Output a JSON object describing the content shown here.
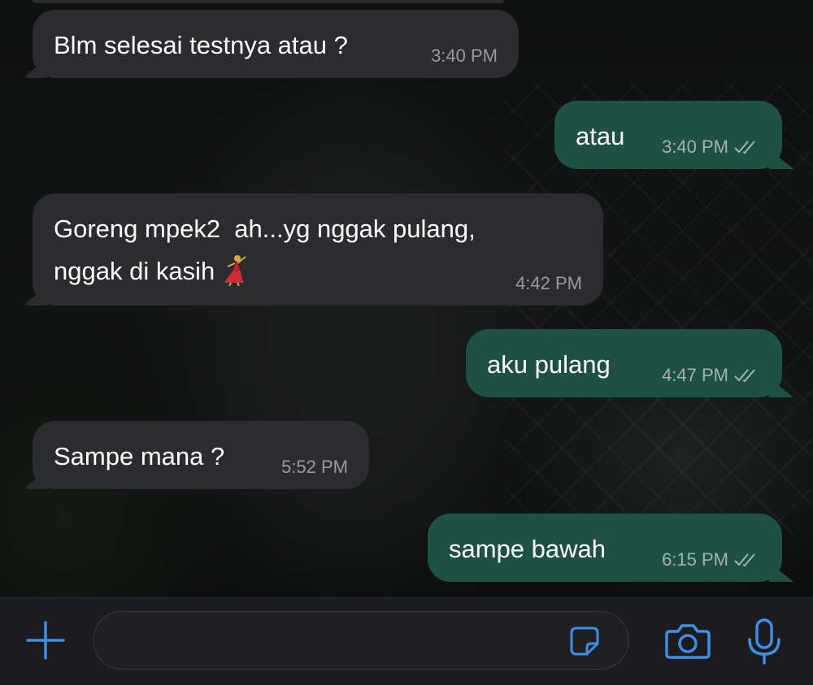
{
  "chat": {
    "messages": [
      {
        "direction": "incoming",
        "text": "Blm selesai testnya atau ?",
        "time": "3:40 PM"
      },
      {
        "direction": "outgoing",
        "text": "atau",
        "time": "3:40 PM",
        "status": "read-double-check-icon"
      },
      {
        "direction": "incoming",
        "text": "Goreng mpek2  ah...yg nggak pulang,\nnggak di kasih",
        "emoji": "dancer-emoji",
        "time": "4:42 PM"
      },
      {
        "direction": "outgoing",
        "text": "aku pulang",
        "time": "4:47 PM",
        "status": "read-double-check-icon"
      },
      {
        "direction": "incoming",
        "text": "Sampe mana ?",
        "time": "5:52 PM"
      },
      {
        "direction": "outgoing",
        "text": "sampe bawah",
        "time": "6:15 PM",
        "status": "read-double-check-icon"
      }
    ]
  },
  "composer": {
    "placeholder": "",
    "icons": [
      "plus-icon",
      "sticker-icon",
      "camera-icon",
      "microphone-icon"
    ],
    "accent_color": "#3d8fe8"
  },
  "colors": {
    "incoming_bubble": "#2c2c2e",
    "outgoing_bubble": "#1e5144",
    "timestamp": "#9a9a9e"
  }
}
